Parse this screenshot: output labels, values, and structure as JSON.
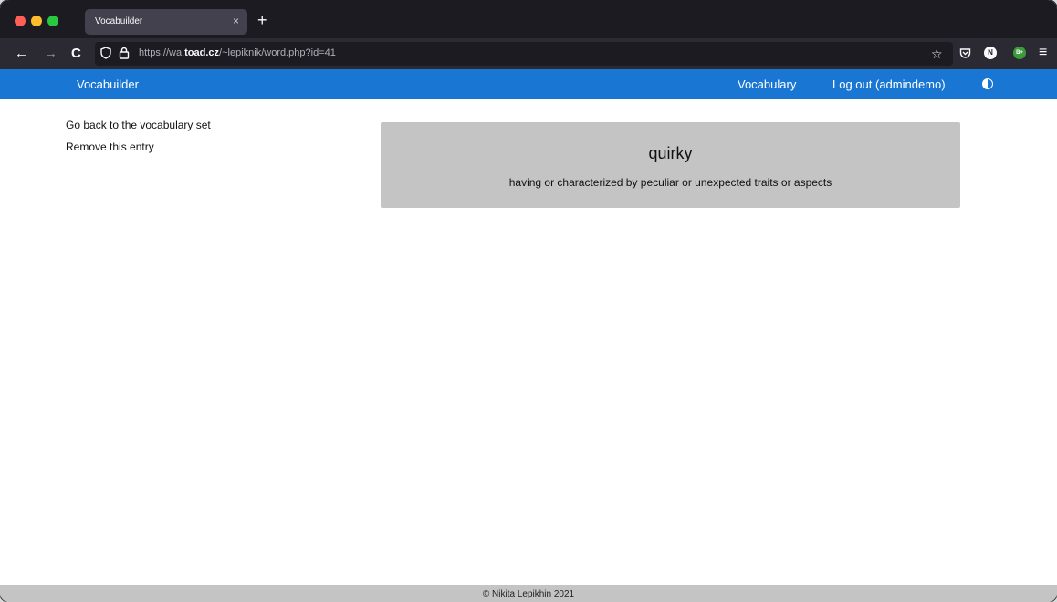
{
  "browser": {
    "tab_title": "Vocabuilder",
    "tab_close": "×",
    "new_tab": "+",
    "url_prefix": "https://wa.",
    "url_domain": "toad.cz",
    "url_path": "/~lepiknik/word.php?id=41",
    "icons": {
      "back": "←",
      "forward": "→",
      "reload": "C",
      "shield": "shield-icon",
      "lock": "lock-icon",
      "star": "☆",
      "pocket": "pocket-icon",
      "menu": "≡"
    },
    "extension_n": "N",
    "extension_b": "B+"
  },
  "appbar": {
    "brand": "Vocabuilder",
    "vocabulary_link": "Vocabulary",
    "logout_link": "Log out (admindemo)",
    "accent_color": "#1976d2"
  },
  "sidebar": {
    "back_link": "Go back to the vocabulary set",
    "remove_link": "Remove this entry"
  },
  "entry": {
    "word": "quirky",
    "definition": "having or characterized by peculiar or unexpected traits or aspects"
  },
  "footer": {
    "text": "© Nikita Lepikhin 2021"
  }
}
